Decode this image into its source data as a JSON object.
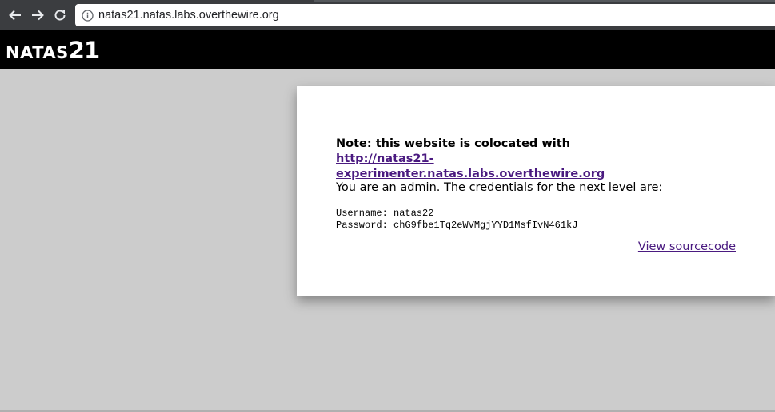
{
  "browser": {
    "url": "natas21.natas.labs.overthewire.org"
  },
  "header": {
    "title_prefix": "NATAS",
    "title_number": "21"
  },
  "content": {
    "note_label": "Note: this website is colocated with ",
    "note_link": "http://natas21-experimenter.natas.labs.overthewire.org",
    "admin_message": "You are an admin. The credentials for the next level are:",
    "username_label": "Username: ",
    "username_value": "natas22",
    "password_label": "Password: ",
    "password_value": "chG9fbe1Tq2eWVMgjYYD1MsfIvN461kJ",
    "view_source_label": "View sourcecode"
  },
  "colors": {
    "page_background": "#cccccc",
    "header_background": "#000000",
    "link": "#4a1a80",
    "browser_chrome": "#3b3d40"
  },
  "icons": {
    "back": "back-arrow-icon",
    "forward": "forward-arrow-icon",
    "reload": "reload-icon",
    "site_info": "info-icon"
  }
}
